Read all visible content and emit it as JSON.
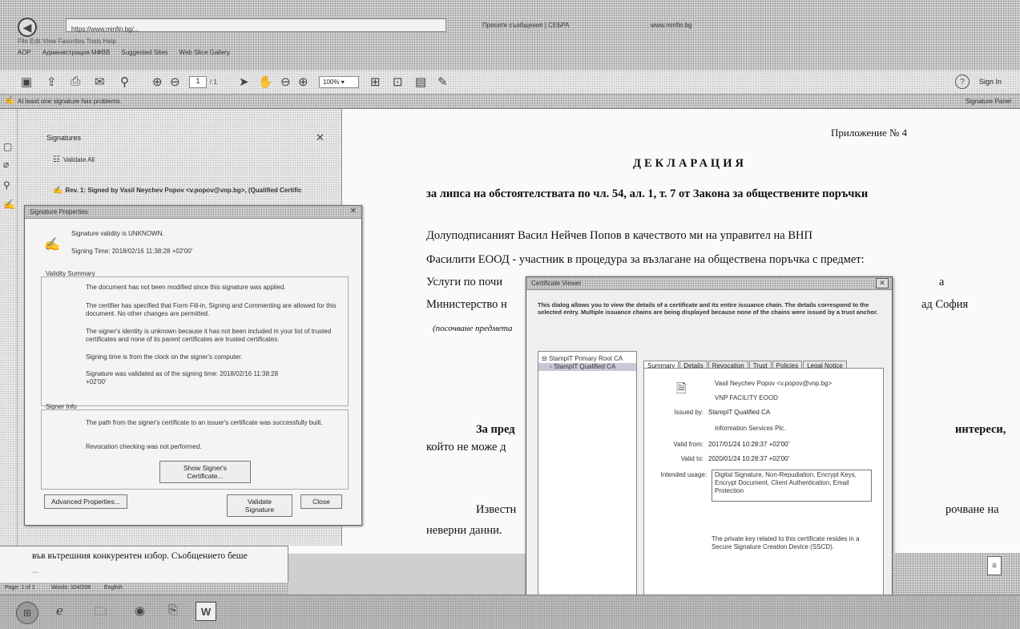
{
  "browser": {
    "url": "https://www.minfin.bg/...",
    "tab1": "Пресите съобщения | СЕБРА",
    "tab2": "www.minfin.bg",
    "menu": "File  Edit  View  Favorites  Tools  Help",
    "bookmark1": "AOP",
    "bookmark2": "Администрация МФВВ",
    "bookmark3": "Suggested Sites",
    "bookmark4": "Web Slice Gallery"
  },
  "toolbar": {
    "page_current": "1",
    "page_total": "/ 1",
    "zoom": "100%",
    "help": "?",
    "sign_in": "Sign In"
  },
  "notice": {
    "text": "At least one signature has problems.",
    "panel_label": "Signature Panel"
  },
  "signatures_panel": {
    "title": "Signatures",
    "validate_all": "Validate All",
    "entry": "Rev. 1: Signed by Vasil Neychev Popov <v.popov@vnp.bg>, (Qualified Certific"
  },
  "sig_props": {
    "title": "Signature Properties",
    "validity": "Signature validity is UNKNOWN.",
    "signing_time": "Signing Time: 2018/02/16 11:38:28 +02'00'",
    "summary_heading": "Validity Summary",
    "summary": [
      "The document has not been modified since this signature was applied.",
      "The certifier has specified that Form Fill-in, Signing and Commenting are allowed for this document. No other changes are permitted.",
      "The signer's identity is unknown because it has not been included in your list of trusted certificates and none of its parent certificates are trusted certificates.",
      "Signing time is from the clock on the signer's computer.",
      "Signature was validated as of the signing time: 2018/02/16 11:38:28 +02'00'"
    ],
    "signer_heading": "Signer Info",
    "signer": [
      "The path from the signer's certificate to an issuer's certificate was successfully built.",
      "Revocation checking was not performed."
    ],
    "show_cert": "Show Signer's Certificate...",
    "advanced": "Advanced Properties...",
    "validate": "Validate Signature",
    "close": "Close"
  },
  "document": {
    "header_right": "Приложение № 4",
    "title": "ДЕКЛАРАЦИЯ",
    "subtitle": "за липса на обстоятелствата по чл. 54, ал. 1, т. 7 от Закона за обществените поръчки",
    "p1a": "Долуподписаният Васил Нейчев Попов в качеството ми на      управител      на      ВНП",
    "p1b": "Фасилити ЕООД - участник в процедура за възлагане на обществена поръчка с предмет:",
    "p1c": "Услуги по почи",
    "p1c_right": "а",
    "p1d": "Министерство н",
    "p1d_right": "ад София",
    "p1e": "(посочване предмета",
    "p2a": "За  пред",
    "p2a_right": "интереси,",
    "p2b": "който не може д",
    "p3a": "Известн",
    "p3a_right": "рочване на",
    "p3b": "неверни данни."
  },
  "cert_viewer": {
    "title": "Certificate Viewer",
    "intro": "This dialog allows you to view the details of a certificate and its entire issuance chain. The details correspond to the selected entry. Multiple issuance chains are being displayed because none of the chains were issued by a trust anchor.",
    "tree": [
      "StampIT Primary Root CA",
      "StampIT Qualified CA"
    ],
    "tabs": [
      "Summary",
      "Details",
      "Revocation",
      "Trust",
      "Policies",
      "Legal Notice"
    ],
    "subject_name": "Vasil Neychev Popov <v.popov@vnp.bg>",
    "subject_org": "VNP FACILITY EOOD",
    "issued_by_label": "Issued by:",
    "issued_by": "StampIT Qualified CA",
    "issued_by_org": "Information Services Plc.",
    "valid_from_label": "Valid from:",
    "valid_from": "2017/01/24 10:28:37 +02'00'",
    "valid_to_label": "Valid to:",
    "valid_to": "2020/01/24 10:28:37 +02'00'",
    "usage_label": "Intended usage:",
    "usage": "Digital Signature, Non-Repudiation, Encrypt Keys, Encrypt Document, Client Authentication, Email Protection",
    "key_note": "The private key related to this certificate resides in a Secure Signature Creation Device (SSCD)."
  },
  "bg_doc": {
    "line1": "във вътрешния конкурентен избор. Съобщението беше",
    "line2": "..."
  },
  "status": {
    "page": "Page: 1 of 1",
    "words": "Words: 104/208",
    "lang": "English"
  },
  "taskbar": {
    "word_label": "W"
  }
}
